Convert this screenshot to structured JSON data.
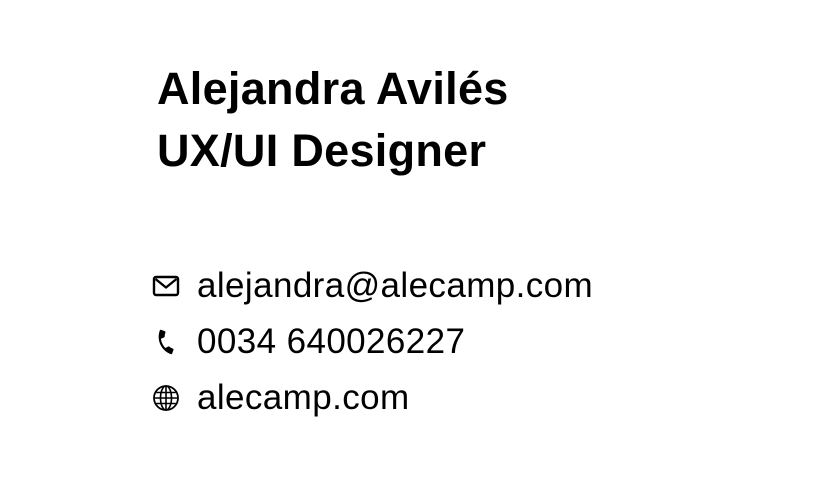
{
  "profile": {
    "name": "Alejandra Avilés",
    "role": "UX/UI Designer"
  },
  "contacts": [
    {
      "icon": "envelope-icon",
      "text": "alejandra@alecamp.com"
    },
    {
      "icon": "phone-icon",
      "text": "0034 640026227"
    },
    {
      "icon": "globe-icon",
      "text": "alecamp.com"
    }
  ],
  "colors": {
    "text": "#000000",
    "background": "#ffffff"
  }
}
